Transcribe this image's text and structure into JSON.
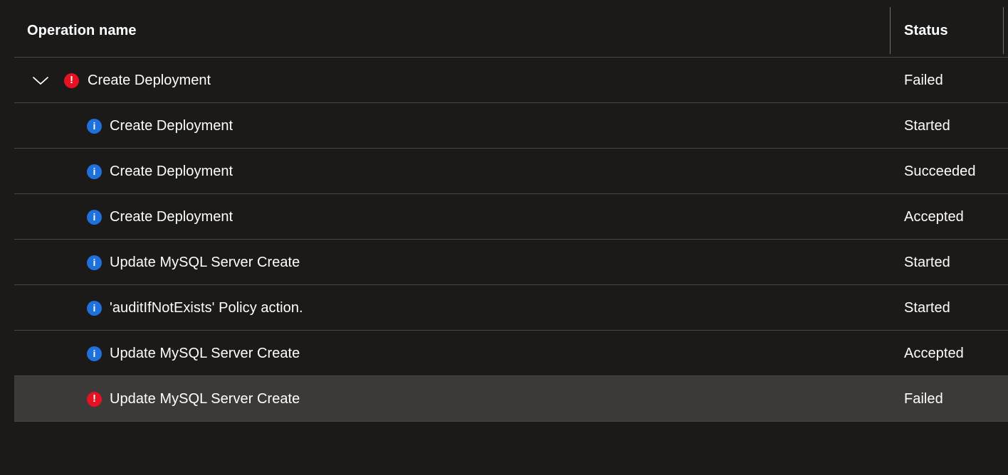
{
  "colors": {
    "background": "#1b1a19",
    "row_divider": "#484644",
    "selected_row": "#3b3a38",
    "error_icon": "#e81123",
    "info_icon": "#1f6fdd",
    "text": "#ffffff",
    "splitter": "#6e6e6e"
  },
  "header": {
    "operation_name_label": "Operation name",
    "status_label": "Status"
  },
  "rows": [
    {
      "operation_name": "Create Deployment",
      "status": "Failed",
      "icon": "error-icon",
      "depth": 0,
      "expandable": true,
      "expanded": true,
      "selected": false,
      "chevron": "chevron-down-icon"
    },
    {
      "operation_name": "Create Deployment",
      "status": "Started",
      "icon": "info-icon",
      "depth": 1,
      "expandable": false,
      "expanded": false,
      "selected": false,
      "chevron": ""
    },
    {
      "operation_name": "Create Deployment",
      "status": "Succeeded",
      "icon": "info-icon",
      "depth": 1,
      "expandable": false,
      "expanded": false,
      "selected": false,
      "chevron": ""
    },
    {
      "operation_name": "Create Deployment",
      "status": "Accepted",
      "icon": "info-icon",
      "depth": 1,
      "expandable": false,
      "expanded": false,
      "selected": false,
      "chevron": ""
    },
    {
      "operation_name": "Update MySQL Server Create",
      "status": "Started",
      "icon": "info-icon",
      "depth": 1,
      "expandable": false,
      "expanded": false,
      "selected": false,
      "chevron": ""
    },
    {
      "operation_name": "'auditIfNotExists' Policy action.",
      "status": "Started",
      "icon": "info-icon",
      "depth": 1,
      "expandable": false,
      "expanded": false,
      "selected": false,
      "chevron": ""
    },
    {
      "operation_name": "Update MySQL Server Create",
      "status": "Accepted",
      "icon": "info-icon",
      "depth": 1,
      "expandable": false,
      "expanded": false,
      "selected": false,
      "chevron": ""
    },
    {
      "operation_name": "Update MySQL Server Create",
      "status": "Failed",
      "icon": "error-icon",
      "depth": 1,
      "expandable": false,
      "expanded": false,
      "selected": true,
      "chevron": ""
    }
  ],
  "icon_glyphs": {
    "error": "!",
    "info": "i"
  }
}
